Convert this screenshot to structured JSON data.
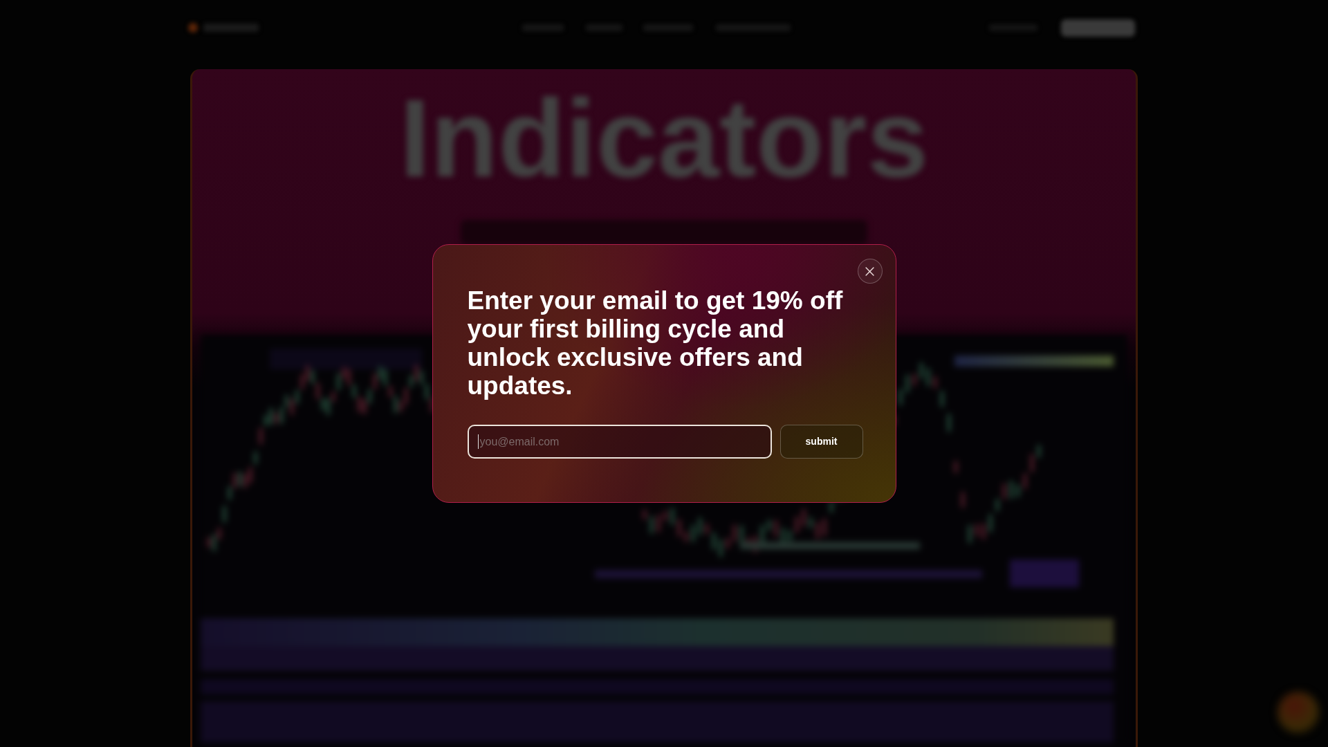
{
  "background_page": {
    "heading": "Indicators"
  },
  "email_popup": {
    "heading": "Enter your email to get 19% off your first billing cycle and unlock exclusive offers and updates.",
    "email_field": {
      "placeholder": "you@email.com",
      "focused": true
    },
    "submit_button": {
      "label": "submit"
    }
  }
}
